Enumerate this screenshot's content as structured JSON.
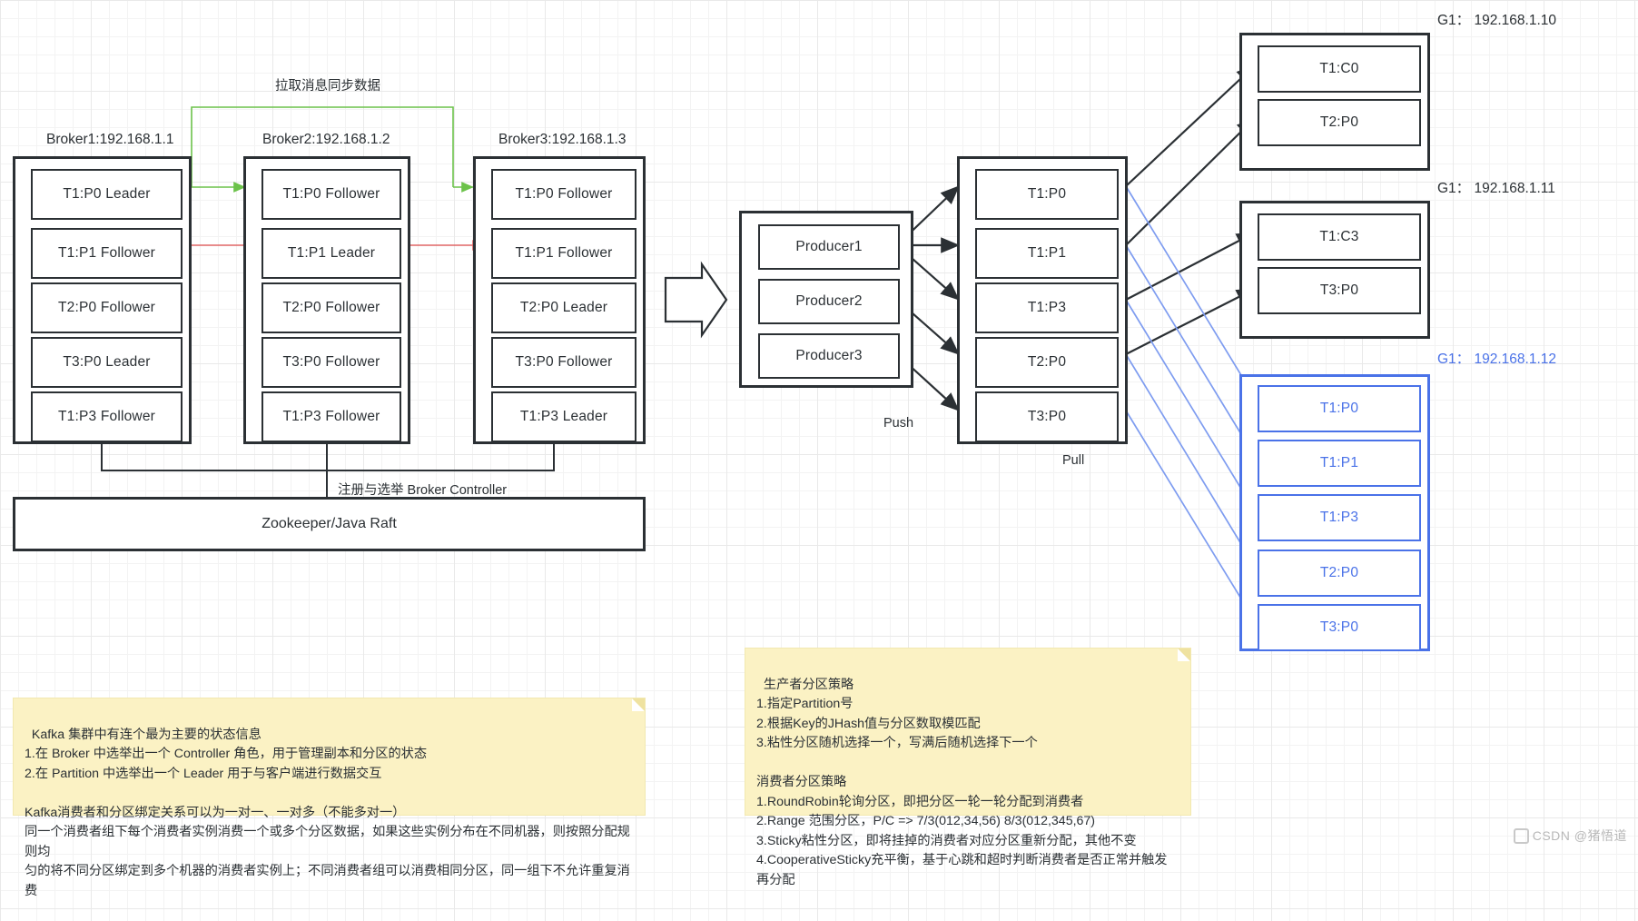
{
  "colors": {
    "ink": "#2b3034",
    "blue": "#4a72e8",
    "green": "#6cc24a",
    "red": "#e06666",
    "note": "#fbf2c4"
  },
  "labels": {
    "sync_pull": "拉取消息同步数据",
    "controller": "注册与选举 Broker Controller",
    "push": "Push",
    "pull": "Pull"
  },
  "brokers": [
    {
      "caption": "Broker1:192.168.1.1",
      "partitions": [
        "T1:P0 Leader",
        "T1:P1 Follower",
        "T2:P0 Follower",
        "T3:P0 Leader",
        "T1:P3 Follower"
      ]
    },
    {
      "caption": "Broker2:192.168.1.2",
      "partitions": [
        "T1:P0 Follower",
        "T1:P1 Leader",
        "T2:P0 Follower",
        "T3:P0 Follower",
        "T1:P3 Follower"
      ]
    },
    {
      "caption": "Broker3:192.168.1.3",
      "partitions": [
        "T1:P0 Follower",
        "T1:P1 Follower",
        "T2:P0 Leader",
        "T3:P0 Follower",
        "T1:P3 Leader"
      ]
    }
  ],
  "zookeeper": {
    "label": "Zookeeper/Java Raft"
  },
  "producers": {
    "items": [
      "Producer1",
      "Producer2",
      "Producer3"
    ]
  },
  "topics": {
    "items": [
      "T1:P0",
      "T1:P1",
      "T1:P3",
      "T2:P0",
      "T3:P0"
    ]
  },
  "consumer_groups": [
    {
      "caption": "G1： 192.168.1.10",
      "style": "dark",
      "items": [
        "T1:C0",
        "T2:P0"
      ]
    },
    {
      "caption": "G1： 192.168.1.11",
      "style": "dark",
      "items": [
        "T1:C3",
        "T3:P0"
      ]
    },
    {
      "caption": "G1： 192.168.1.12",
      "style": "blue",
      "items": [
        "T1:P0",
        "T1:P1",
        "T1:P3",
        "T2:P0",
        "T3:P0"
      ]
    }
  ],
  "notes": {
    "cluster": "Kafka 集群中有连个最为主要的状态信息\n1.在 Broker 中选举出一个 Controller 角色，用于管理副本和分区的状态\n2.在 Partition 中选举出一个 Leader 用于与客户端进行数据交互\n\nKafka消费者和分区绑定关系可以为一对一、一对多（不能多对一）\n同一个消费者组下每个消费者实例消费一个或多个分区数据，如果这些实例分布在不同机器，则按照分配规则均\n匀的将不同分区绑定到多个机器的消费者实例上；不同消费者组可以消费相同分区，同一组下不允许重复消费",
    "strategy": "生产者分区策略\n1.指定Partition号\n2.根据Key的JHash值与分区数取模匹配\n3.粘性分区随机选择一个，写满后随机选择下一个\n\n消费者分区策略\n1.RoundRobin轮询分区，即把分区一轮一轮分配到消费者\n2.Range 范围分区，P/C => 7/3(012,34,56) 8/3(012,345,67)\n3.Sticky粘性分区，即将挂掉的消费者对应分区重新分配，其他不变\n4.CooperativeSticky充平衡，基于心跳和超时判断消费者是否正常并触发再分配"
  },
  "watermark": {
    "text": "CSDN @猪悟道"
  }
}
